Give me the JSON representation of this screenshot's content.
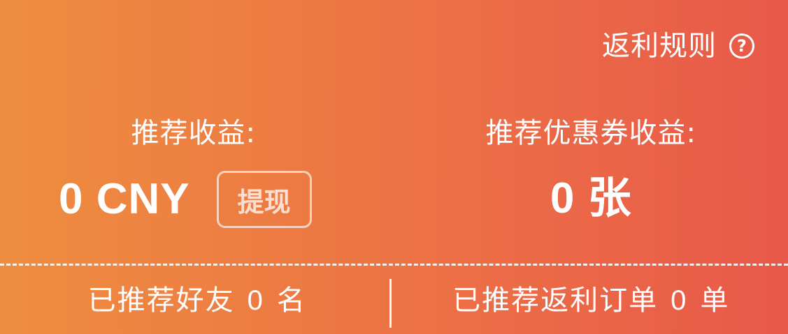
{
  "rules_link": {
    "label": "返利规则",
    "icon": "help-circle-icon"
  },
  "stats": {
    "referral_income": {
      "label": "推荐收益:",
      "value": "0 CNY",
      "action_label": "提现"
    },
    "coupon_income": {
      "label": "推荐优惠券收益:",
      "value": "0 张"
    }
  },
  "bottom": {
    "friends": {
      "prefix": "已推荐好友",
      "count": "0",
      "suffix": "名"
    },
    "orders": {
      "prefix": "已推荐返利订单",
      "count": "0",
      "suffix": "单"
    }
  },
  "colors": {
    "gradient_start": "#ee8d3f",
    "gradient_end": "#e8584a",
    "text": "#ffffff"
  }
}
